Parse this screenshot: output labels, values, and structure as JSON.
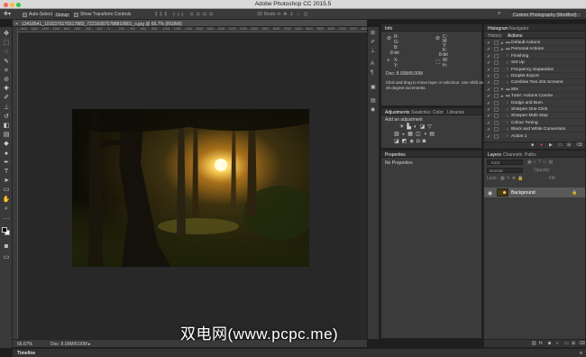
{
  "window": {
    "title": "Adobe Photoshop CC 2015.5"
  },
  "options_bar": {
    "auto_select_label": "Auto-Select:",
    "auto_select_value": "Group",
    "transform_label": "Show Transform Controls",
    "mode_3d_label": "3D Mode:",
    "workspace": "Custom Photography (Modified)"
  },
  "document": {
    "tab_label": "13418541_1015375175517883_722160875788810801_o.jpg @ 66.7% (RGB/8)",
    "zoom": "66.67%",
    "doc_size": "Doc: 8.00M/8.00M"
  },
  "ruler": {
    "top_ticks": [
      "1600",
      "1400",
      "1200",
      "1000",
      "800",
      "600",
      "400",
      "200",
      "0",
      "200",
      "400",
      "600",
      "800",
      "1000",
      "1200",
      "1400",
      "1600",
      "1800",
      "2000",
      "2200",
      "2400",
      "2600",
      "2800",
      "3000",
      "3200",
      "3400",
      "3600",
      "3800",
      "4000",
      "4200",
      "4400",
      "4600"
    ]
  },
  "info_panel": {
    "tab": "Info",
    "r": "R:",
    "g": "G:",
    "b": "B:",
    "bit": "8-bit",
    "c": "C:",
    "m": "M:",
    "y": "Y:",
    "k": "K:",
    "x": "X:",
    "y_coord": "Y:",
    "w": "W:",
    "h": "H:",
    "doc": "Doc: 8.00M/8.00M",
    "hint": "Click and drag to move layer or selection. Use Shift and Alt for additional options.",
    "hint_line2": "45 degree increments."
  },
  "adjustments_panel": {
    "tabs": [
      "Adjustments",
      "Swatches",
      "Color",
      "Libraries"
    ],
    "add_label": "Add an adjustment"
  },
  "properties_panel": {
    "tab": "Properties",
    "empty": "No Properties"
  },
  "history_panel": {
    "top_tabs": [
      "Histogram",
      "Navigator"
    ],
    "tabs": [
      "History",
      "Actions"
    ],
    "actions": [
      {
        "label": "Default Actions",
        "type": "folder",
        "indent": 0
      },
      {
        "label": "Personal Actions",
        "type": "folder",
        "indent": 0
      },
      {
        "label": "Finishing",
        "type": "action",
        "indent": 1
      },
      {
        "label": "Set Up",
        "type": "action",
        "indent": 1
      },
      {
        "label": "Frequency Separation",
        "type": "action",
        "indent": 1
      },
      {
        "label": "Droplet Export",
        "type": "action",
        "indent": 1
      },
      {
        "label": "Combine Two iOS Screens",
        "type": "action",
        "indent": 1
      },
      {
        "label": "80s",
        "type": "folder",
        "indent": 0
      },
      {
        "label": "Tutor: Actions Course",
        "type": "folder",
        "indent": 0
      },
      {
        "label": "Dodge and Burn",
        "type": "action",
        "indent": 1
      },
      {
        "label": "Sharpen One Click",
        "type": "action",
        "indent": 1
      },
      {
        "label": "Sharpen Multi Step",
        "type": "action",
        "indent": 1
      },
      {
        "label": "Colour Toning",
        "type": "action",
        "indent": 1
      },
      {
        "label": "Black and White Conversion",
        "type": "action",
        "indent": 1
      },
      {
        "label": "Action 1",
        "type": "action",
        "indent": 1
      }
    ]
  },
  "layers_panel": {
    "tabs": [
      "Layers",
      "Channels",
      "Paths"
    ],
    "kind": "Kind",
    "blend": "Normal",
    "opacity_label": "Opacity:",
    "lock_label": "Lock:",
    "fill_label": "Fill:",
    "layers": [
      {
        "name": "Background",
        "locked": true
      }
    ]
  },
  "timeline": {
    "label": "Timeline"
  },
  "watermark": {
    "text": "双电网(www.pcpc.me)"
  },
  "tools": [
    {
      "icon": "move-tool-icon",
      "glyph": "✥"
    },
    {
      "icon": "marquee-tool-icon",
      "glyph": "⬚"
    },
    {
      "icon": "lasso-tool-icon",
      "glyph": "◌"
    },
    {
      "icon": "quick-select-tool-icon",
      "glyph": "✎"
    },
    {
      "icon": "crop-tool-icon",
      "glyph": "⌗"
    },
    {
      "icon": "eyedropper-tool-icon",
      "glyph": "⊘"
    },
    {
      "icon": "healing-brush-tool-icon",
      "glyph": "✚"
    },
    {
      "icon": "brush-tool-icon",
      "glyph": "✐"
    },
    {
      "icon": "clone-stamp-tool-icon",
      "glyph": "⊥"
    },
    {
      "icon": "history-brush-tool-icon",
      "glyph": "↺"
    },
    {
      "icon": "eraser-tool-icon",
      "glyph": "◧"
    },
    {
      "icon": "gradient-tool-icon",
      "glyph": "▤"
    },
    {
      "icon": "blur-tool-icon",
      "glyph": "◆"
    },
    {
      "icon": "dodge-tool-icon",
      "glyph": "●"
    },
    {
      "icon": "pen-tool-icon",
      "glyph": "✒"
    },
    {
      "icon": "type-tool-icon",
      "glyph": "T"
    },
    {
      "icon": "path-select-tool-icon",
      "glyph": "➤"
    },
    {
      "icon": "shape-tool-icon",
      "glyph": "▭"
    },
    {
      "icon": "hand-tool-icon",
      "glyph": "✋"
    },
    {
      "icon": "zoom-tool-icon",
      "glyph": "⌕"
    },
    {
      "icon": "more-tools-icon",
      "glyph": "…"
    }
  ]
}
